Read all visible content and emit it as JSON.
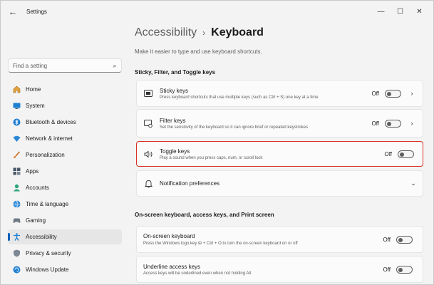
{
  "window": {
    "title": "Settings"
  },
  "search": {
    "placeholder": "Find a setting"
  },
  "sidebar": {
    "items": [
      {
        "label": "Home",
        "icon": "home-icon"
      },
      {
        "label": "System",
        "icon": "system-icon"
      },
      {
        "label": "Bluetooth & devices",
        "icon": "bluetooth-icon"
      },
      {
        "label": "Network & internet",
        "icon": "network-icon"
      },
      {
        "label": "Personalization",
        "icon": "brush-icon"
      },
      {
        "label": "Apps",
        "icon": "apps-icon"
      },
      {
        "label": "Accounts",
        "icon": "accounts-icon"
      },
      {
        "label": "Time & language",
        "icon": "globe-icon"
      },
      {
        "label": "Gaming",
        "icon": "gaming-icon"
      },
      {
        "label": "Accessibility",
        "icon": "accessibility-icon",
        "active": true
      },
      {
        "label": "Privacy & security",
        "icon": "shield-icon"
      },
      {
        "label": "Windows Update",
        "icon": "update-icon"
      }
    ]
  },
  "main": {
    "breadcrumb": {
      "parent": "Accessibility",
      "separator": "›",
      "current": "Keyboard"
    },
    "description": "Make it easier to type and use keyboard shortcuts.",
    "section1": {
      "title": "Sticky, Filter, and Toggle keys",
      "cards": [
        {
          "title": "Sticky keys",
          "subtitle": "Press keyboard shortcuts that use multiple keys (such as Ctrl + S) one key at a time",
          "state": "Off",
          "chevron": true,
          "icon": "sticky-keys-icon"
        },
        {
          "title": "Filter keys",
          "subtitle": "Set the sensitivity of the keyboard so it can ignore brief or repeated keystrokes",
          "state": "Off",
          "chevron": true,
          "icon": "filter-keys-icon"
        },
        {
          "title": "Toggle keys",
          "subtitle": "Play a sound when you press caps, num, or scroll lock",
          "state": "Off",
          "chevron": false,
          "icon": "speaker-icon",
          "highlight": true
        }
      ],
      "notification": {
        "title": "Notification preferences",
        "icon": "bell-icon"
      }
    },
    "section2": {
      "title": "On-screen keyboard, access keys, and Print screen",
      "cards": [
        {
          "title": "On-screen keyboard",
          "subtitle": "Press the Windows logo key ⊞ + Ctrl + O to turn the on-screen keyboard on or off",
          "state": "Off"
        },
        {
          "title": "Underline access keys",
          "subtitle": "Access keys will be underlined even when not holding Alt",
          "state": "Off"
        }
      ]
    }
  },
  "colors": {
    "accent": "#005fb8",
    "highlight_border": "#d93025"
  }
}
